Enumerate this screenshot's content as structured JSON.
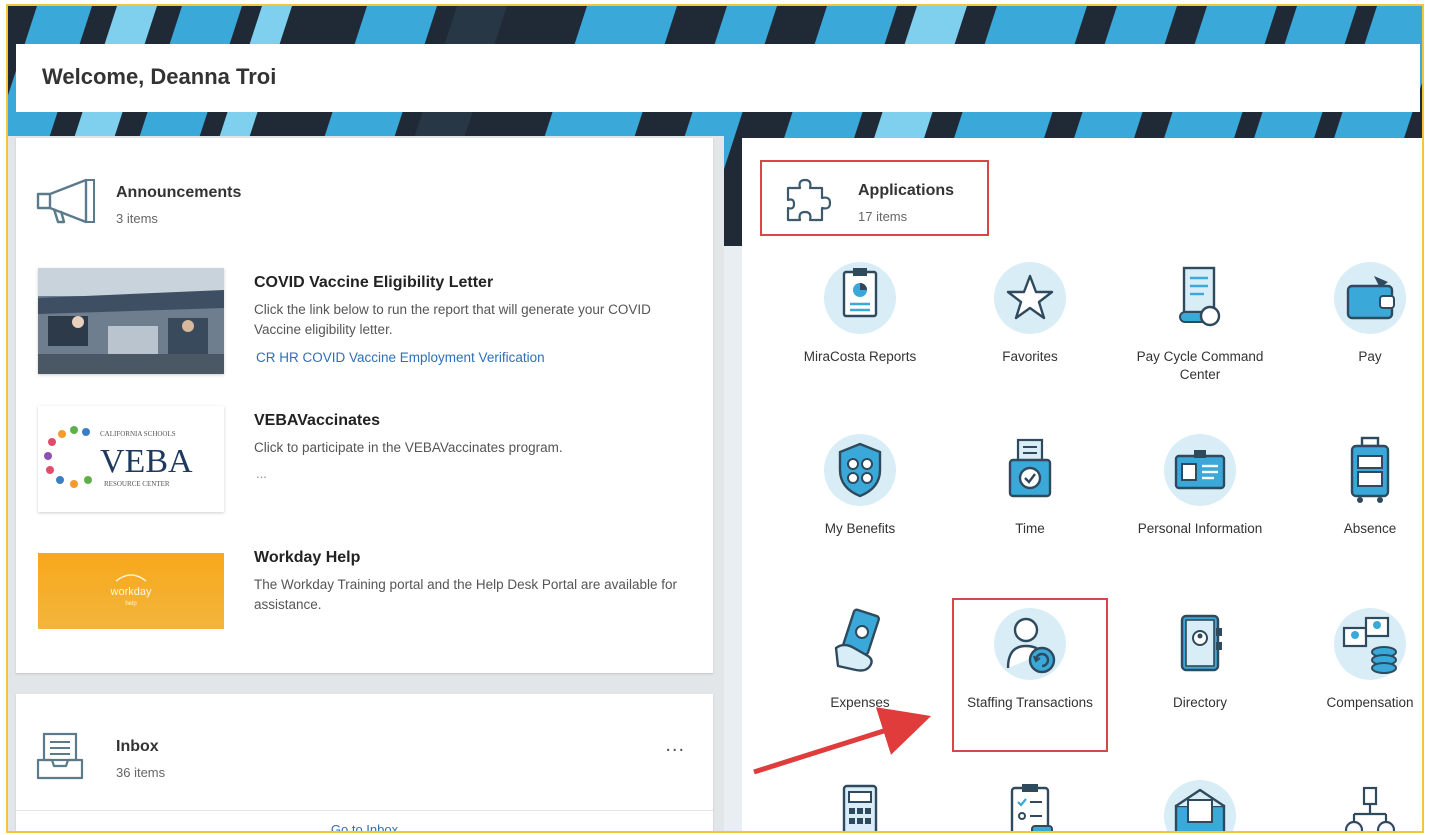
{
  "welcome": {
    "text": "Welcome,  Deanna Troi"
  },
  "announcements": {
    "title": "Announcements",
    "count": "3 items",
    "items": [
      {
        "title": "COVID Vaccine Eligibility Letter",
        "description": "Click the link below to run the report that will generate your COVID Vaccine eligibility letter.",
        "link": "CR HR COVID Vaccine Employment Verification"
      },
      {
        "title": "VEBAVaccinates",
        "description": "Click to participate in the VEBAVaccinates program.",
        "more": "...",
        "logo": {
          "top": "CALIFORNIA SCHOOLS",
          "main": "VEBA",
          "bottom": "RESOURCE CENTER"
        }
      },
      {
        "title": "Workday Help",
        "description": "The Workday Training portal and the Help Desk Portal are available for assistance.",
        "logo": {
          "main": "workday",
          "sub": "help"
        }
      }
    ]
  },
  "inbox": {
    "title": "Inbox",
    "count": "36 items",
    "more_label": "...",
    "goto_label": "Go to Inbox"
  },
  "applications": {
    "title": "Applications",
    "count": "17 items",
    "apps": [
      {
        "label": "MiraCosta Reports",
        "icon": "report-clipboard-icon"
      },
      {
        "label": "Favorites",
        "icon": "star-icon"
      },
      {
        "label": "Pay Cycle Command Center",
        "icon": "pay-cycle-icon"
      },
      {
        "label": "Pay",
        "icon": "wallet-icon"
      },
      {
        "label": "My Benefits",
        "icon": "benefits-shield-icon"
      },
      {
        "label": "Time",
        "icon": "time-clock-icon"
      },
      {
        "label": "Personal Information",
        "icon": "id-card-icon"
      },
      {
        "label": "Absence",
        "icon": "suitcase-icon"
      },
      {
        "label": "Expenses",
        "icon": "expenses-hand-icon"
      },
      {
        "label": "Staffing Transactions",
        "icon": "staffing-person-icon"
      },
      {
        "label": "Directory",
        "icon": "directory-book-icon"
      },
      {
        "label": "Compensation",
        "icon": "compensation-icon"
      },
      {
        "label": "",
        "icon": "calculator-icon"
      },
      {
        "label": "",
        "icon": "checklist-icon"
      },
      {
        "label": "",
        "icon": "envelope-icon"
      },
      {
        "label": "",
        "icon": "org-chart-icon"
      }
    ]
  },
  "colors": {
    "accent": "#3aa8d8",
    "highlight": "#d8464a",
    "link": "#2f6fb7",
    "frame": "#f0c63a"
  }
}
